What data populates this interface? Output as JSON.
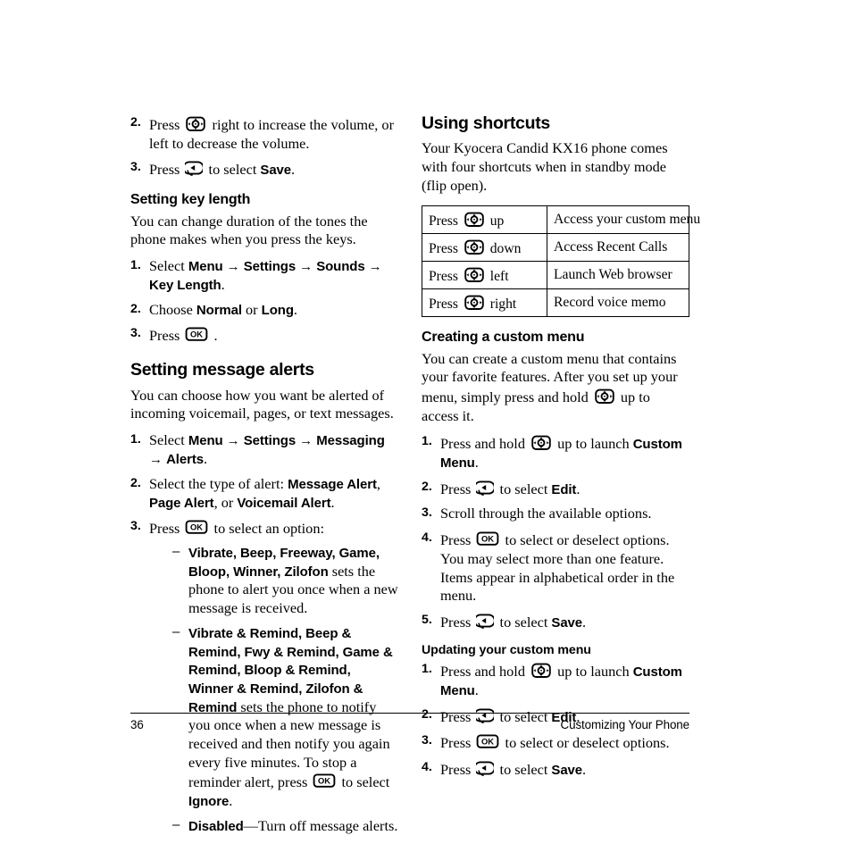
{
  "document": {
    "page_number": "36",
    "running_footer": "Customizing Your Phone"
  },
  "left_column": {
    "continued_steps": {
      "step2": {
        "number": "2.",
        "text_before_icon": "Press",
        "icon": "navigation-key-icon",
        "text_after_icon": "right to increase the volume, or left to decrease the volume."
      },
      "step3": {
        "number": "3.",
        "text_before_icon": "Press",
        "icon": "left-softkey-icon",
        "text_after_icon": "to select",
        "bold_term": "Save",
        "text_end": "."
      }
    },
    "setting_key_length": {
      "heading": "Setting key length",
      "intro": "You can change duration of the tones the phone makes when you press the keys.",
      "steps": [
        {
          "number": "1.",
          "lead": "Select",
          "path": [
            "Menu",
            "Settings",
            "Sounds",
            "Key Length"
          ],
          "arrow": "→",
          "end": "."
        },
        {
          "number": "2.",
          "lead": "Choose",
          "option_a": "Normal",
          "conjunction": "or",
          "option_b": "Long",
          "end": "."
        },
        {
          "number": "3.",
          "lead": "Press",
          "icon": "ok-key-icon",
          "end": "."
        }
      ]
    },
    "setting_message_alerts": {
      "heading": "Setting message alerts",
      "intro": "You can choose how you want be alerted of incoming voicemail, pages, or text messages.",
      "steps": [
        {
          "number": "1.",
          "lead": "Select",
          "path": [
            "Menu",
            "Settings",
            "Messaging",
            "Alerts"
          ],
          "arrow": "→",
          "end": "."
        },
        {
          "number": "2.",
          "lead": "Select the type of alert:",
          "alerts": [
            "Message Alert",
            "Page Alert",
            "Voicemail Alert"
          ],
          "conjunction": "or",
          "end": "."
        },
        {
          "number": "3.",
          "lead": "Press",
          "icon": "ok-key-icon",
          "tail": "to select an option:"
        }
      ],
      "options": [
        {
          "dash": "–",
          "bold": "Vibrate, Beep, Freeway, Game, Bloop, Winner, Zilofon",
          "text": " sets the phone to alert you once when a new message is received."
        },
        {
          "dash": "–",
          "bold": "Vibrate & Remind, Beep & Remind, Fwy & Remind, Game & Remind, Bloop & Remind, Winner & Remind, Zilofon & Remind",
          "text_part1": " sets the phone to notify you once when a new message is received and then notify you again every five minutes. To stop a reminder alert, press ",
          "icon": "ok-key-icon",
          "text_part2": " to select ",
          "bold_end": "Ignore",
          "end": "."
        },
        {
          "dash": "–",
          "bold": "Disabled",
          "text": "—Turn off message alerts."
        }
      ]
    }
  },
  "right_column": {
    "using_shortcuts": {
      "heading": "Using shortcuts",
      "intro": "Your Kyocera Candid KX16 phone comes with four shortcuts when in standby mode (flip open).",
      "table": {
        "rows": [
          {
            "press_label": "Press",
            "icon": "navigation-key-icon",
            "direction": "up",
            "action": "Access your custom menu"
          },
          {
            "press_label": "Press",
            "icon": "navigation-key-icon",
            "direction": "down",
            "action": "Access Recent Calls"
          },
          {
            "press_label": "Press",
            "icon": "navigation-key-icon",
            "direction": "left",
            "action": "Launch Web browser"
          },
          {
            "press_label": "Press",
            "icon": "navigation-key-icon",
            "direction": "right",
            "action": "Record voice memo"
          }
        ]
      }
    },
    "creating_custom_menu": {
      "heading": "Creating a custom menu",
      "intro_part1": "You can create a custom menu that contains your favorite features. After you set up your menu, simply press and hold ",
      "intro_icon": "navigation-key-icon",
      "intro_part2": " up to access it.",
      "steps": [
        {
          "number": "1.",
          "lead": "Press and hold",
          "icon": "navigation-key-icon",
          "tail": "up to launch",
          "bold": "Custom Menu",
          "end": "."
        },
        {
          "number": "2.",
          "lead": "Press",
          "icon": "left-softkey-icon",
          "tail": "to select",
          "bold": "Edit",
          "end": "."
        },
        {
          "number": "3.",
          "lead": "Scroll through the available options."
        },
        {
          "number": "4.",
          "lead": "Press",
          "icon": "ok-key-icon",
          "tail": "to select or deselect options. You may select more than one feature. Items appear in alphabetical order in the menu."
        },
        {
          "number": "5.",
          "lead": "Press",
          "icon": "left-softkey-icon",
          "tail": "to select",
          "bold": "Save",
          "end": "."
        }
      ]
    },
    "updating_custom_menu": {
      "heading": "Updating your custom menu",
      "steps": [
        {
          "number": "1.",
          "lead": "Press and hold",
          "icon": "navigation-key-icon",
          "tail": "up to launch",
          "bold": "Custom Menu",
          "end": "."
        },
        {
          "number": "2.",
          "lead": "Press",
          "icon": "left-softkey-icon",
          "tail": "to select",
          "bold": "Edit",
          "end": "."
        },
        {
          "number": "3.",
          "lead": "Press",
          "icon": "ok-key-icon",
          "tail": "to select or deselect options."
        },
        {
          "number": "4.",
          "lead": "Press",
          "icon": "left-softkey-icon",
          "tail": "to select",
          "bold": "Save",
          "end": "."
        }
      ]
    }
  },
  "icons": {
    "navigation_key": "navigation-key-icon",
    "left_softkey": "left-softkey-icon",
    "ok_key": "ok-key-icon"
  }
}
